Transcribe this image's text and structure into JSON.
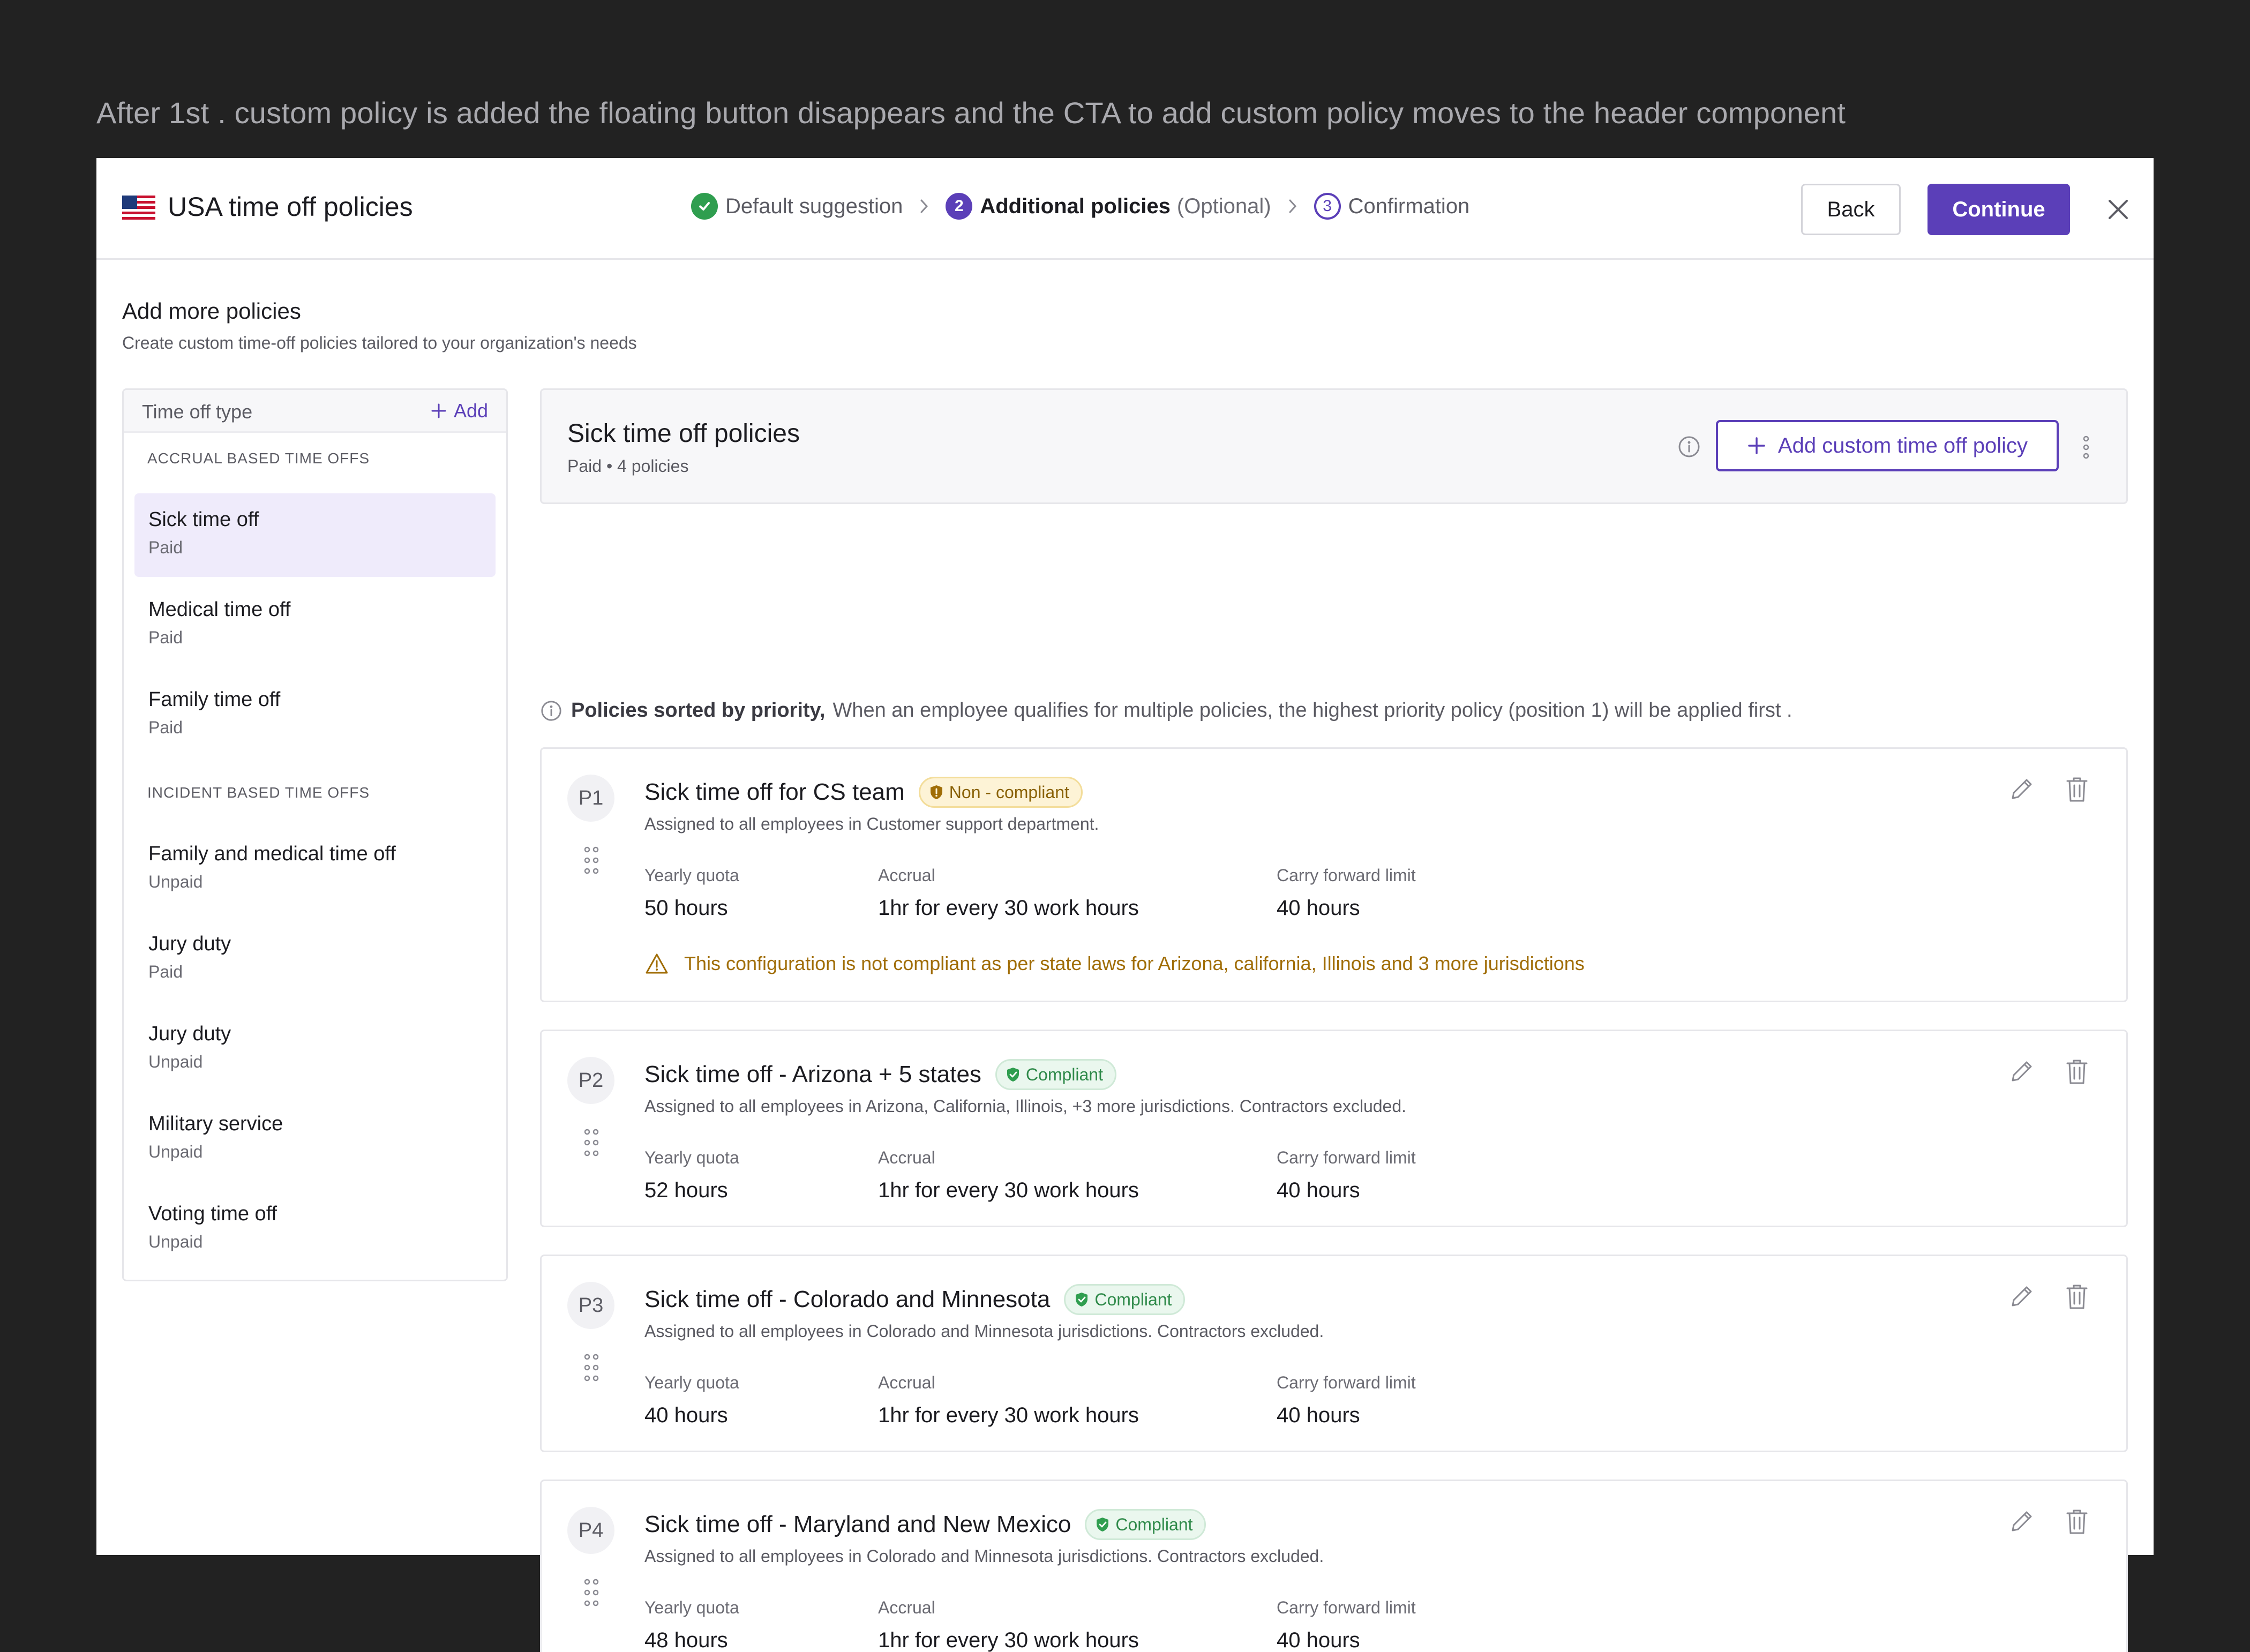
{
  "annotation": "After 1st . custom policy is added the floating button disappears and the CTA to add custom policy moves to the header component",
  "header": {
    "title": "USA time off policies",
    "steps": [
      {
        "number": "",
        "label": "Default suggestion",
        "suffix": "",
        "state": "done"
      },
      {
        "number": "2",
        "label": "Additional policies",
        "suffix": "(Optional)",
        "state": "active"
      },
      {
        "number": "3",
        "label": "Confirmation",
        "suffix": "",
        "state": "upcoming"
      }
    ],
    "back_label": "Back",
    "continue_label": "Continue"
  },
  "section": {
    "title": "Add more policies",
    "subtitle": "Create custom time-off policies tailored to your organization's needs"
  },
  "sidebar": {
    "header_label": "Time off type",
    "add_label": "Add",
    "groups": [
      {
        "title": "ACCRUAL BASED TIME OFFS",
        "items": [
          {
            "name": "Sick time off",
            "kind": "Paid",
            "active": true
          },
          {
            "name": "Medical time off",
            "kind": "Paid"
          },
          {
            "name": "Family time off",
            "kind": "Paid"
          }
        ]
      },
      {
        "title": "INCIDENT BASED TIME OFFS",
        "items": [
          {
            "name": "Family and medical time off",
            "kind": "Unpaid"
          },
          {
            "name": "Jury duty",
            "kind": "Paid"
          },
          {
            "name": "Jury duty",
            "kind": "Unpaid"
          },
          {
            "name": "Military service",
            "kind": "Unpaid"
          },
          {
            "name": "Voting time off",
            "kind": "Unpaid"
          }
        ]
      }
    ]
  },
  "main": {
    "title": "Sick time off policies",
    "subtitle": "Paid • 4 policies",
    "add_custom_label": "Add custom time off policy",
    "priority_note_strong": "Policies sorted by priority,",
    "priority_note_text": "When an employee qualifies for multiple policies, the highest priority policy (position 1) will be applied first ."
  },
  "policies": [
    {
      "priority": "P1",
      "title": "Sick time off for CS team",
      "status": "Non - compliant",
      "description": "Assigned to all employees in Customer support department.",
      "metrics": [
        {
          "label": "Yearly quota",
          "value": "50 hours"
        },
        {
          "label": "Accrual",
          "value": "1hr for every 30 work hours"
        },
        {
          "label": "Carry forward limit",
          "value": "40 hours"
        }
      ],
      "warning": "This configuration is not compliant as per state laws for Arizona, california, Illinois and 3 more jurisdictions"
    },
    {
      "priority": "P2",
      "title": "Sick time off - Arizona + 5 states",
      "status": "Compliant",
      "description": "Assigned to all employees in Arizona, California, Illinois, +3 more jurisdictions. Contractors excluded.",
      "metrics": [
        {
          "label": "Yearly quota",
          "value": "52 hours"
        },
        {
          "label": "Accrual",
          "value": "1hr for every 30 work hours"
        },
        {
          "label": "Carry forward limit",
          "value": "40 hours"
        }
      ]
    },
    {
      "priority": "P3",
      "title": "Sick time off - Colorado and Minnesota",
      "status": "Compliant",
      "description": "Assigned to all employees in Colorado and Minnesota jurisdictions. Contractors excluded.",
      "metrics": [
        {
          "label": "Yearly quota",
          "value": "40 hours"
        },
        {
          "label": "Accrual",
          "value": "1hr for every 30 work hours"
        },
        {
          "label": "Carry forward limit",
          "value": "40 hours"
        }
      ]
    },
    {
      "priority": "P4",
      "title": "Sick time off - Maryland and New Mexico",
      "status": "Compliant",
      "description": "Assigned to all employees in Colorado and Minnesota jurisdictions. Contractors excluded.",
      "metrics": [
        {
          "label": "Yearly quota",
          "value": "48 hours"
        },
        {
          "label": "Accrual",
          "value": "1hr for every 30 work hours"
        },
        {
          "label": "Carry forward limit",
          "value": "40 hours"
        }
      ]
    }
  ],
  "colors": {
    "accent": "#5b3fb8",
    "success": "#2f9e4f",
    "warning": "#a06d06",
    "backdrop": "#222222"
  },
  "icons": {
    "flag": "us-flag-icon",
    "step_done": "check-circle-icon",
    "separator": "chevron-right-icon",
    "close": "close-icon",
    "add": "plus-icon",
    "info": "info-icon",
    "more": "kebab-menu-icon",
    "drag": "drag-handle-icon",
    "edit": "pencil-icon",
    "delete": "trash-icon",
    "warning": "warning-triangle-icon",
    "compliant": "shield-check-icon",
    "non_compliant": "shield-alert-icon"
  }
}
